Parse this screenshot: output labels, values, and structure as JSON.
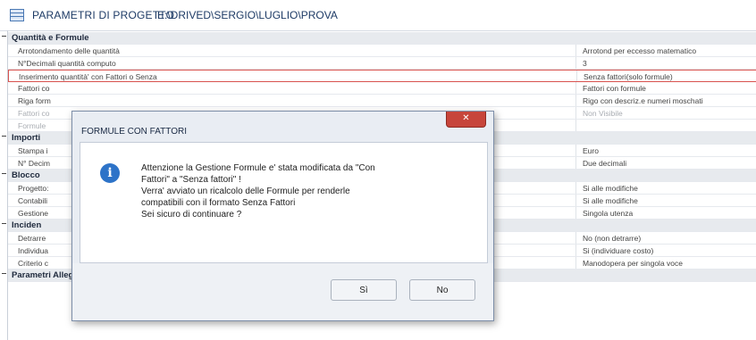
{
  "window": {
    "title": "PARAMETRI DI PROGETTO",
    "path": "E:\\DRIVED\\SERGIO\\LUGLIO\\PROVA"
  },
  "grid": {
    "rows": [
      {
        "type": "category",
        "name": "Quantità e Formule"
      },
      {
        "type": "prop",
        "name": "Arrotondamento delle quantità",
        "value": "Arrotond per eccesso matematico"
      },
      {
        "type": "prop",
        "name": "N°Decimali quantità computo",
        "value": "3"
      },
      {
        "type": "prop",
        "name": "Inserimento quantità' con Fattori o Senza",
        "value": "Senza fattori(solo formule)"
      },
      {
        "type": "prop",
        "name": "Fattori co",
        "value": "Fattori con formule"
      },
      {
        "type": "prop",
        "name": "Riga form",
        "value": "Rigo con descriz.e numeri moschati"
      },
      {
        "type": "prop",
        "name": "Fattori co",
        "value": "Non Visibile"
      },
      {
        "type": "prop",
        "name": "Formule",
        "value": ""
      },
      {
        "type": "category",
        "name": "Importi"
      },
      {
        "type": "prop",
        "name": "Stampa i",
        "value": "Euro"
      },
      {
        "type": "prop",
        "name": "N° Decim",
        "value": "Due decimali"
      },
      {
        "type": "category",
        "name": "Blocco"
      },
      {
        "type": "prop",
        "name": "Progetto:",
        "value": "Si alle modifiche"
      },
      {
        "type": "prop",
        "name": "Contabili",
        "value": "Si alle modifiche"
      },
      {
        "type": "prop",
        "name": "Gestione",
        "value": "Singola utenza"
      },
      {
        "type": "category",
        "name": "Inciden"
      },
      {
        "type": "prop",
        "name": "Detrarre",
        "value": "No (non detrarre)"
      },
      {
        "type": "prop",
        "name": "Individua",
        "value": "Si (individuare costo)"
      },
      {
        "type": "prop",
        "name": "Criterio c",
        "value": "Manodopera per singola voce"
      },
      {
        "type": "category",
        "name": "Parametri Allegati Grafici"
      }
    ]
  },
  "dialog": {
    "title": "FORMULE CON FATTORI",
    "close_label": "✕",
    "message_lines": [
      "Attenzione la Gestione Formule e' stata modificata da \"Con",
      "Fattori\" a \"Senza fattori\" !",
      "Verra' avviato un ricalcolo delle Formule per renderle",
      "compatibili con il formato Senza Fattori",
      "Sei sicuro di continuare ?"
    ],
    "yes_label": "Sì",
    "no_label": "No"
  }
}
